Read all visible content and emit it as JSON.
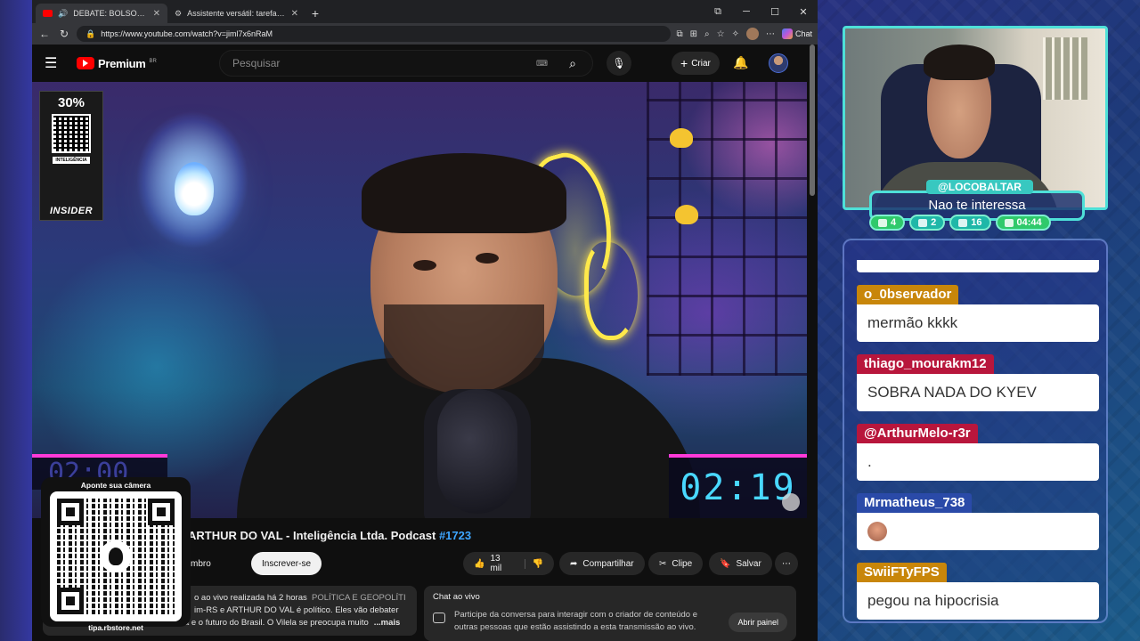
{
  "browser": {
    "tabs": [
      {
        "title": "DEBATE: BOLSONARISTA X M…",
        "active": true
      },
      {
        "title": "Assistente versátil: tarefas, respost…",
        "active": false
      }
    ],
    "url": "https://www.youtube.com/watch?v=jiml7x6nRaM",
    "chat_label": "Chat"
  },
  "youtube": {
    "logo_text": "Premium",
    "region": "BR",
    "search_placeholder": "Pesquisar",
    "create_label": "Criar",
    "video": {
      "timer_right": "02:19",
      "timer_left": "02:00",
      "promo": {
        "percent": "30%",
        "brand": "INSIDER",
        "tag": "INTELIGÊNCIA"
      }
    },
    "title_prefix": "X MBL: RONY GABRIEL E ARTHUR DO VAL - Inteligência Ltda. Podcast ",
    "title_hashtag": "#1723",
    "join_label": "eja membro",
    "subscribe_label": "Inscrever-se",
    "likes": "13 mil",
    "share_label": "Compartilhar",
    "clip_label": "Clipe",
    "save_label": "Salvar",
    "description": {
      "line1_text": "o ao vivo realizada há 2 horas",
      "line1_tag": "POLÍTICA E GEOPOLÍTI",
      "line2": "im-RS e ARTHUR DO VAL é político. Eles vão debater",
      "line3": "sobre Bolsonaro, o político da direita e o futuro do Brasil. O Vilela se preocupa muito",
      "more": "...mais"
    },
    "live_chat": {
      "header": "Chat ao vivo",
      "body": "Participe da conversa para interagir com o criador de conteúdo e outras pessoas que estão assistindo a esta transmissão ao vivo.",
      "open_button": "Abrir painel"
    }
  },
  "qr_overlay": {
    "caption": "Aponte sua câmera",
    "site": "tipa.rbstore.net"
  },
  "webcam": {
    "username": "@LOCOBALTAR",
    "message": "Nao te interessa",
    "stats": [
      {
        "icon": "chat-icon",
        "value": "4"
      },
      {
        "icon": "youtube-icon",
        "value": "2"
      },
      {
        "icon": "link-icon",
        "value": "16"
      },
      {
        "icon": "whatsapp-clock-icon",
        "value": "04:44"
      }
    ]
  },
  "chat_messages": [
    {
      "user": "o_0bservador",
      "text": "mermão kkkk",
      "color": "#c8860a"
    },
    {
      "user": "thiago_mourakm12",
      "text": "SOBRA NADA DO KYEV",
      "color": "#b8163c"
    },
    {
      "user": "@ArthurMelo-r3r",
      "text": ".",
      "color": "#b8163c"
    },
    {
      "user": "Mrmatheus_738",
      "text": "",
      "color": "#2a4aa8",
      "emote": true
    },
    {
      "user": "SwiiFTyFPS",
      "text": "pegou na hipocrisia",
      "color": "#c8860a"
    }
  ],
  "colors": {
    "accent_teal": "#4ee0d8",
    "youtube_red": "#ff0000",
    "timer_cyan": "#49d8ff",
    "timer_border": "#ff3ad8"
  }
}
